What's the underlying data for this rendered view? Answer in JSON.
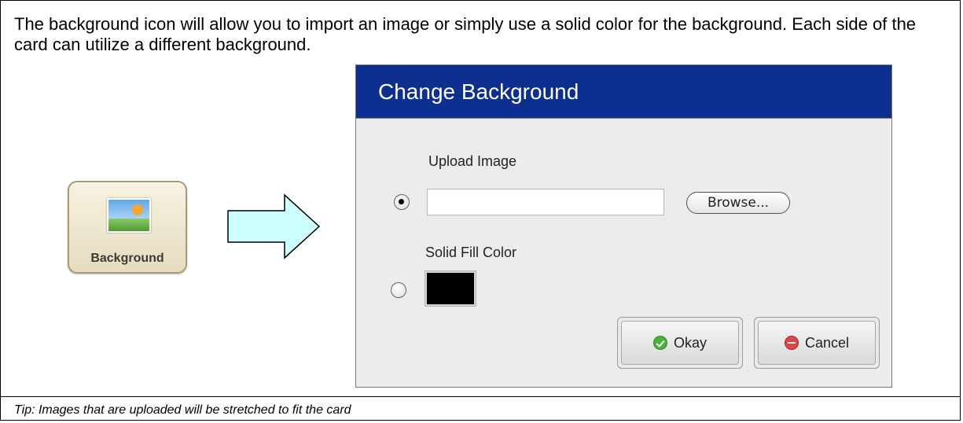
{
  "intro_text": "The background icon will allow you to import an image or simply use a solid color for the background.  Each side of the card can utilize a different background.",
  "tip_text": "Tip:  Images that are uploaded will be stretched to fit the card",
  "background_button": {
    "label": "Background",
    "icon": "landscape-image-icon"
  },
  "arrow": {
    "icon": "right-arrow-icon",
    "fill_color": "#ccffff"
  },
  "dialog": {
    "title": "Change Background",
    "title_bar_color": "#0d2f90",
    "upload_section": {
      "label": "Upload Image",
      "selected": true,
      "file_value": "",
      "browse_label": "Browse..."
    },
    "fill_section": {
      "label": "Solid Fill Color",
      "selected": false,
      "color": "#000000"
    },
    "buttons": {
      "okay_label": "Okay",
      "okay_icon": "check-circle-icon",
      "cancel_label": "Cancel",
      "cancel_icon": "minus-circle-icon"
    }
  }
}
